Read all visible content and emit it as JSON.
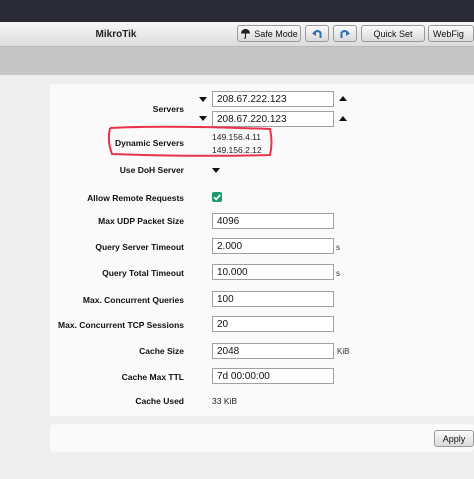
{
  "app": {
    "title": "MikroTik"
  },
  "toolbar": {
    "safe_mode_label": "Safe Mode",
    "undo_icon": "undo-icon",
    "redo_icon": "redo-icon",
    "quick_set_label": "Quick Set",
    "webfig_label": "WebFig"
  },
  "form": {
    "servers": {
      "label": "Servers",
      "values": [
        "208.67.222.123",
        "208.67.220.123"
      ]
    },
    "dynamic_servers": {
      "label": "Dynamic Servers",
      "values": [
        "149.156.4.11",
        "149.156.2.12"
      ]
    },
    "use_doh_server": {
      "label": "Use DoH Server"
    },
    "allow_remote_requests": {
      "label": "Allow Remote Requests",
      "checked": true
    },
    "max_udp_packet_size": {
      "label": "Max UDP Packet Size",
      "value": "4096"
    },
    "query_server_timeout": {
      "label": "Query Server Timeout",
      "value": "2.000",
      "unit": "s"
    },
    "query_total_timeout": {
      "label": "Query Total Timeout",
      "value": "10.000",
      "unit": "s"
    },
    "max_concurrent_queries": {
      "label": "Max. Concurrent Queries",
      "value": "100"
    },
    "max_concurrent_tcp_sessions": {
      "label": "Max. Concurrent TCP Sessions",
      "value": "20"
    },
    "cache_size": {
      "label": "Cache Size",
      "value": "2048",
      "unit": "KiB"
    },
    "cache_max_ttl": {
      "label": "Cache Max TTL",
      "value": "7d 00:00:00"
    },
    "cache_used": {
      "label": "Cache Used",
      "value": "33 KiB"
    }
  },
  "footer": {
    "apply_label": "Apply"
  },
  "colors": {
    "checkbox": "#1e9a6e",
    "annotation": "#e8334a",
    "topbar": "#2b2b35"
  }
}
